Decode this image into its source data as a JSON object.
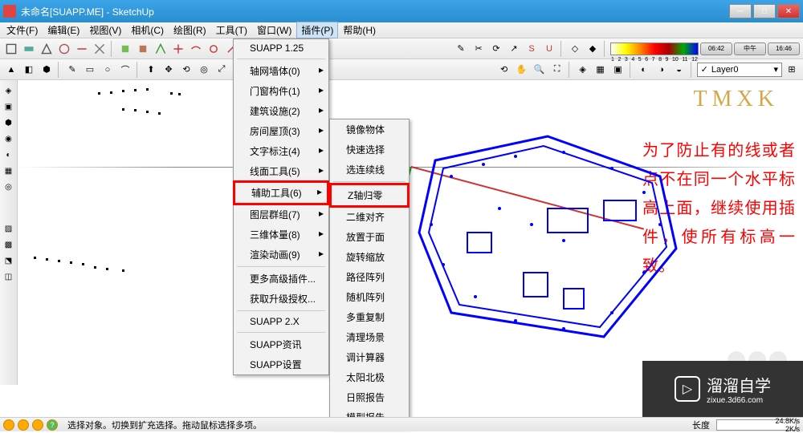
{
  "window": {
    "title": "未命名[SUAPP.ME] - SketchUp",
    "min": "─",
    "max": "□",
    "close": "✕"
  },
  "menu": {
    "items": [
      "文件(F)",
      "编辑(E)",
      "视图(V)",
      "相机(C)",
      "绘图(R)",
      "工具(T)",
      "窗口(W)",
      "插件(P)",
      "帮助(H)"
    ],
    "active_index": 7
  },
  "toolbar": {
    "layer_label": "Layer0",
    "time1": "06:42",
    "time2": "中午",
    "time3": "16:46",
    "gradient_nums": [
      "1",
      "2",
      "3",
      "4",
      "5",
      "6",
      "7",
      "8",
      "9",
      "10",
      "11",
      "12"
    ]
  },
  "dropdown1": {
    "items": [
      {
        "label": "SUAPP 1.25",
        "arrow": false,
        "sep_after": true
      },
      {
        "label": "轴网墙体(0)",
        "arrow": true
      },
      {
        "label": "门窗构件(1)",
        "arrow": true
      },
      {
        "label": "建筑设施(2)",
        "arrow": true
      },
      {
        "label": "房间屋顶(3)",
        "arrow": true
      },
      {
        "label": "文字标注(4)",
        "arrow": true
      },
      {
        "label": "线面工具(5)",
        "arrow": true
      },
      {
        "label": "辅助工具(6)",
        "arrow": true,
        "highlight": true
      },
      {
        "label": "图层群组(7)",
        "arrow": true
      },
      {
        "label": "三维体量(8)",
        "arrow": true
      },
      {
        "label": "渲染动画(9)",
        "arrow": true,
        "sep_after": true
      },
      {
        "label": "更多高级插件...",
        "arrow": false
      },
      {
        "label": "获取升级授权...",
        "arrow": false,
        "sep_after": true
      },
      {
        "label": "SUAPP 2.X",
        "arrow": false,
        "sep_after": true
      },
      {
        "label": "SUAPP资讯",
        "arrow": false
      },
      {
        "label": "SUAPP设置",
        "arrow": false
      }
    ]
  },
  "dropdown2": {
    "items": [
      {
        "label": "镜像物体"
      },
      {
        "label": "快速选择"
      },
      {
        "label": "选连续线",
        "sep_after": true
      },
      {
        "label": "Z轴归零",
        "highlight": true
      },
      {
        "label": "二维对齐"
      },
      {
        "label": "放置于面"
      },
      {
        "label": "旋转缩放"
      },
      {
        "label": "路径阵列"
      },
      {
        "label": "随机阵列"
      },
      {
        "label": "多重复制"
      },
      {
        "label": "清理场景"
      },
      {
        "label": "调计算器"
      },
      {
        "label": "太阳北极"
      },
      {
        "label": "日照报告"
      },
      {
        "label": "模型报告"
      }
    ]
  },
  "canvas": {
    "watermark": "TMXK",
    "annotation": "为了防止有的线或者点不在同一个水平标高上面，继续使用插件，使所有标高一致。"
  },
  "overlay": {
    "brand": "溜溜自学",
    "url": "zixue.3d66.com"
  },
  "statusbar": {
    "text": "选择对象。切换到扩充选择。拖动鼠标选择多项。",
    "length_label": "长度",
    "speed": "24.8K/s",
    "speed2": "2K/s"
  }
}
